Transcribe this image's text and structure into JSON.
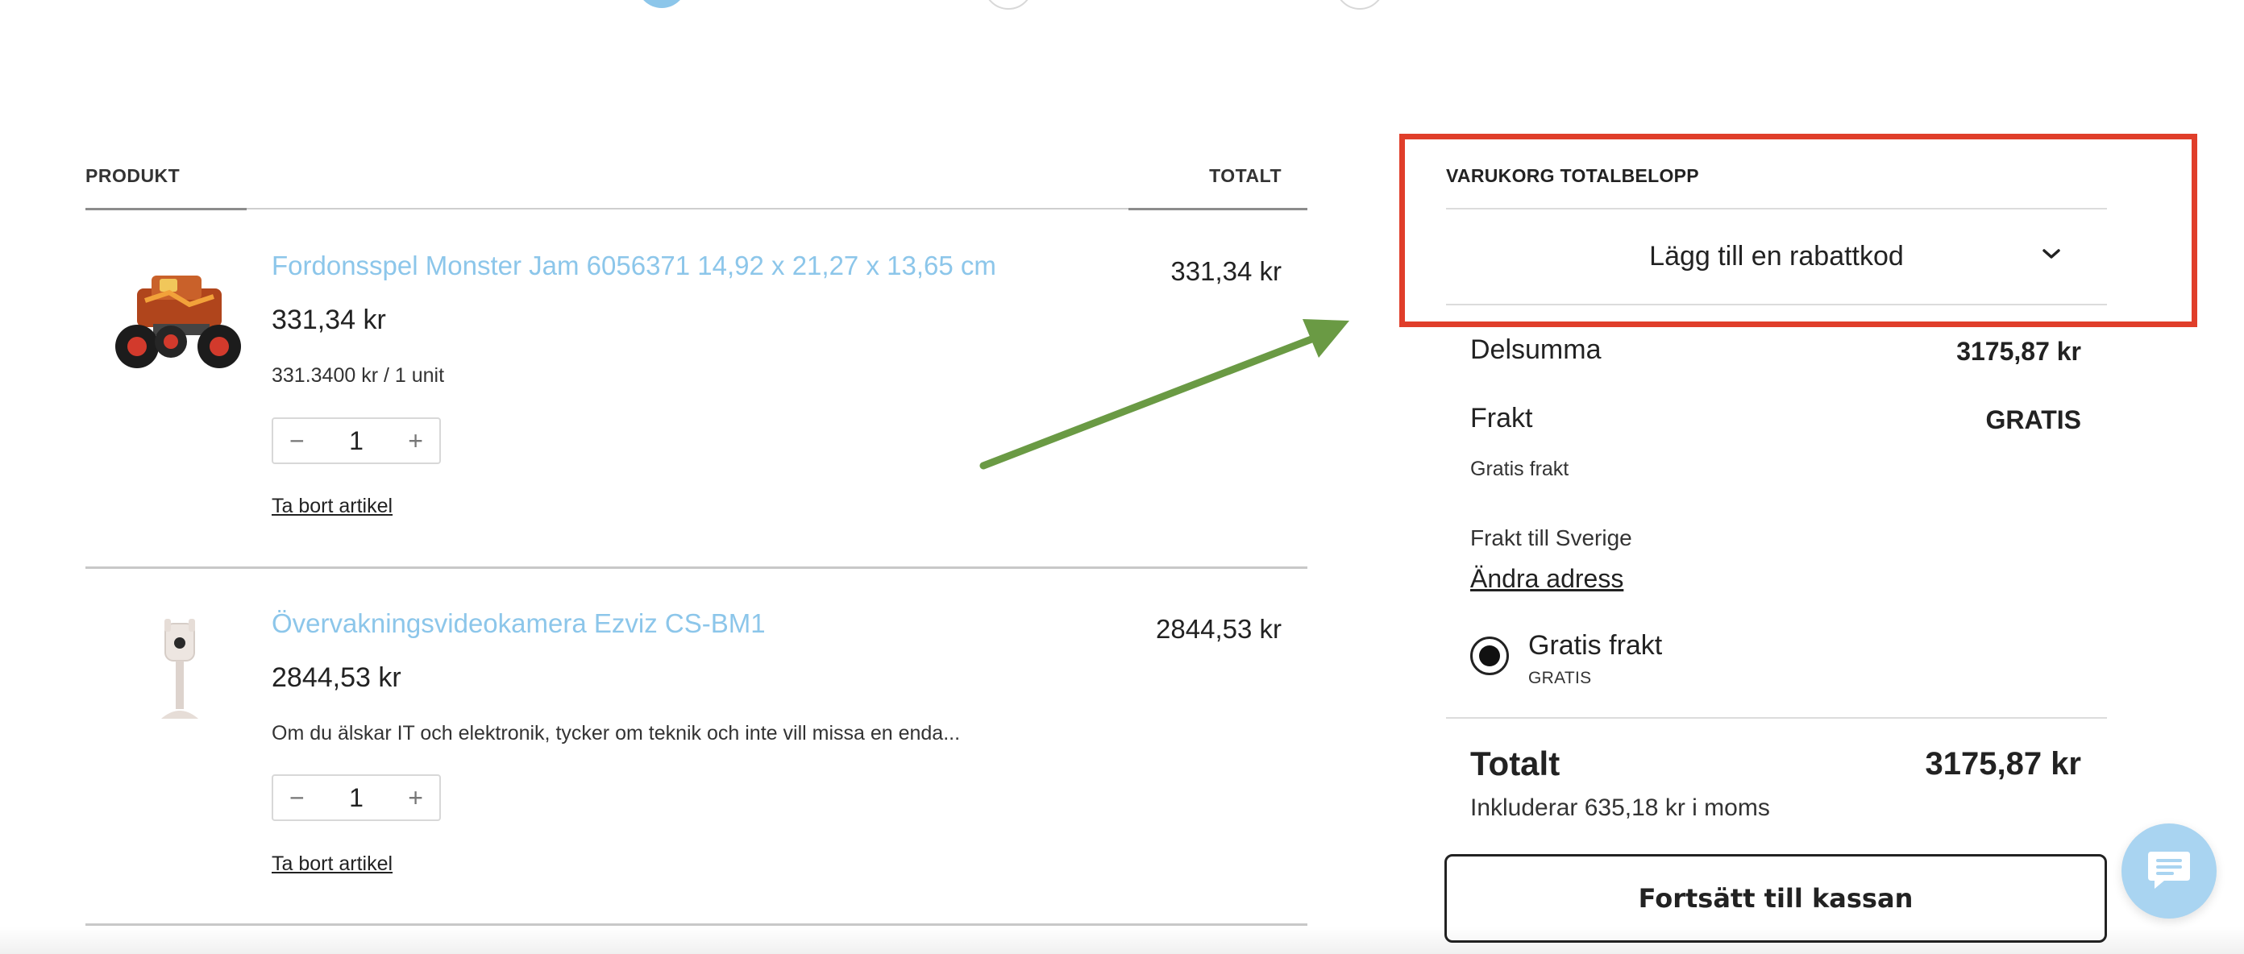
{
  "steps": [
    {
      "state": "active"
    },
    {
      "state": "todo"
    },
    {
      "state": "todo"
    }
  ],
  "cart": {
    "col_product": "PRODUKT",
    "col_total": "TOTALT",
    "items": [
      {
        "name": "Fordonsspel Monster Jam 6056371 14,92 x 21,27 x 13,65 cm",
        "price": "331,34 kr",
        "info": "331.3400 kr / 1 unit",
        "qty": "1",
        "line_total": "331,34 kr",
        "remove": "Ta bort artikel",
        "image_icon": "monster-truck-image"
      },
      {
        "name": "Övervakningsvideokamera Ezviz CS-BM1",
        "price": "2844,53 kr",
        "info": "Om du älskar IT och elektronik, tycker om teknik och inte vill missa en enda...",
        "qty": "1",
        "line_total": "2844,53 kr",
        "remove": "Ta bort artikel",
        "image_icon": "baby-monitor-camera-image"
      }
    ],
    "minus_symbol": "−",
    "plus_symbol": "+"
  },
  "summary": {
    "title": "VARUKORG TOTALBELOPP",
    "discount_label": "Lägg till en rabattkod",
    "subtotal_label": "Delsumma",
    "subtotal_value": "3175,87 kr",
    "shipping_label": "Frakt",
    "shipping_value": "GRATIS",
    "shipping_note": "Gratis frakt",
    "shipping_destination": "Frakt till Sverige",
    "change_address": "Ändra adress",
    "option_label": "Gratis frakt",
    "option_sub": "GRATIS",
    "total_label": "Totalt",
    "total_value": "3175,87 kr",
    "vat_note": "Inkluderar 635,18 kr i moms",
    "checkout_button": "Fortsätt till kassan"
  },
  "colors": {
    "accent_link": "#8cc6ea",
    "highlight_box": "#e03e2a",
    "arrow": "#6a9a44",
    "chat_bubble": "#a9d4f1"
  }
}
